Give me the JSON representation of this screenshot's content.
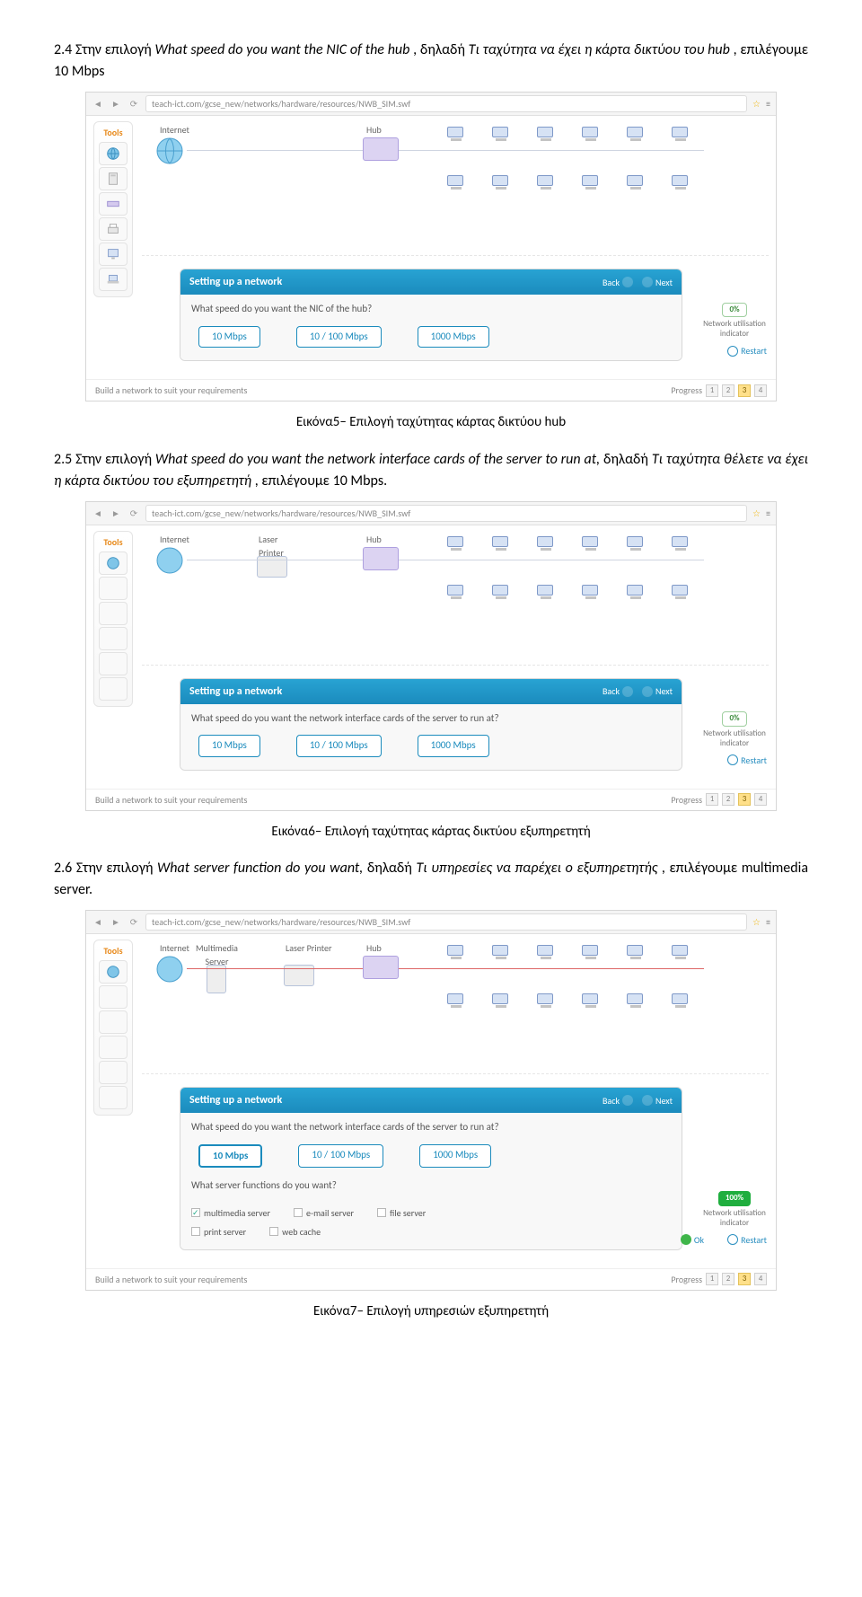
{
  "sec24": {
    "text_a": "2.4 Στην επιλογή ",
    "text_b": "What speed do you want the NIC of the hub",
    "text_c": ", δηλαδή ",
    "text_d": "Τι ταχύτητα να έχει η κάρτα δικτύου του hub",
    "text_e": ", επιλέγουμε 10 Mbps"
  },
  "browser": {
    "url": "teach-ict.com/gcse_new/networks/hardware/resources/NWB_SIM.swf"
  },
  "toolbox_label": "Tools",
  "topo": {
    "internet": "Internet",
    "hub": "Hub",
    "laser": "Laser\nPrinter",
    "mserver": "Multimedia\nServer"
  },
  "dialog": {
    "title": "Setting up a network",
    "back": "Back",
    "next": "Next",
    "q1": "What speed do you want the NIC of the hub?",
    "q2": "What speed do you want the network interface cards of the server to run at?",
    "q2b": "What server functions do you want?",
    "opts": [
      "10 Mbps",
      "10 / 100 Mbps",
      "1000 Mbps"
    ],
    "chk": [
      "multimedia server",
      "e-mail server",
      "file server",
      "print server",
      "web cache"
    ]
  },
  "indicator": {
    "pct0": "0%",
    "pct100": "100%",
    "label": "Network utilisation indicator"
  },
  "restart": "Restart",
  "ok": "Ok",
  "footer_left": "Build a network to suit your requirements",
  "footer_prog": "Progress",
  "caption5": "Εικόνα5– Επιλογή ταχύτητας κάρτας δικτύου hub",
  "sec25": {
    "a": "2.5 Στην επιλογή ",
    "b": "What speed do you want the network interface cards of the server to run at,",
    "c": " δηλαδή ",
    "d": "Τι ταχύτητα θέλετε να έχει η κάρτα δικτύου του εξυπηρετητή",
    "e": ", επιλέγουμε 10 Mbps."
  },
  "caption6": "Εικόνα6– Επιλογή ταχύτητας κάρτας δικτύου εξυπηρετητή",
  "sec26": {
    "a": "2.6 Στην επιλογή ",
    "b": "What server function do you want,",
    "c": " δηλαδή ",
    "d": "Τι υπηρεσίες να παρέχει ο εξυπηρετητής",
    "e": ", επιλέγουμε multimedia server."
  },
  "caption7": "Εικόνα7– Επιλογή υπηρεσιών εξυπηρετητή"
}
